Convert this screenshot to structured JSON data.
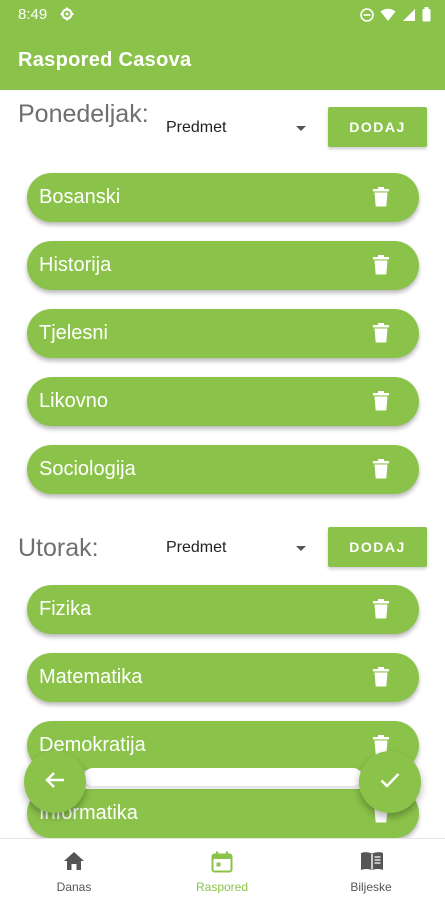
{
  "status_bar": {
    "time": "8:49",
    "icons": [
      "gear-icon",
      "dnd-icon",
      "wifi-icon",
      "signal-icon",
      "battery-icon"
    ]
  },
  "app_bar": {
    "title": "Raspored Casova"
  },
  "colors": {
    "accent": "#8bc34a",
    "background": "#ffffff",
    "day_label": "#6f6f6f"
  },
  "days": [
    {
      "label": "Ponedeljak:",
      "select_value": "Predmet",
      "add_label": "DODAJ",
      "subjects": [
        "Bosanski",
        "Historija",
        "Tjelesni",
        "Likovno",
        "Sociologija"
      ]
    },
    {
      "label": "Utorak:",
      "select_value": "Predmet",
      "add_label": "DODAJ",
      "subjects": [
        "Fizika",
        "Matematika",
        "Demokratija",
        "Informatika"
      ]
    }
  ],
  "fabs": {
    "back_icon": "arrow-left-icon",
    "confirm_icon": "check-icon"
  },
  "bottom_nav": {
    "items": [
      {
        "label": "Danas",
        "icon": "home-icon",
        "active": false
      },
      {
        "label": "Raspored",
        "icon": "calendar-icon",
        "active": true
      },
      {
        "label": "Biljeske",
        "icon": "book-icon",
        "active": false
      }
    ]
  }
}
